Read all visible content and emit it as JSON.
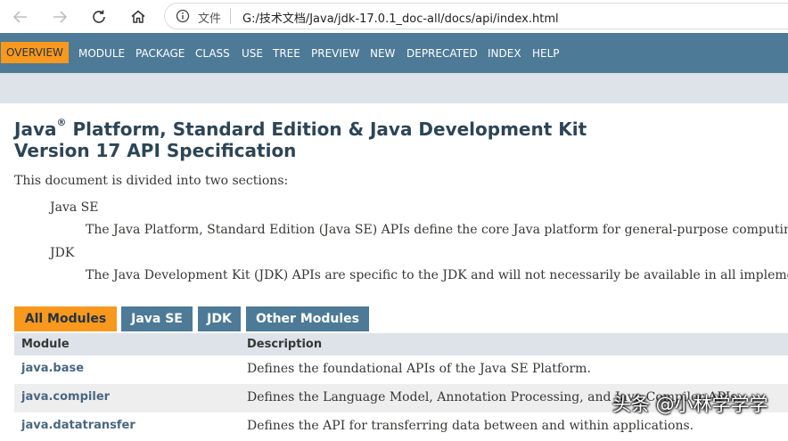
{
  "browser": {
    "file_label": "文件",
    "url": "G:/技术文档/Java/jdk-17.0.1_doc-all/docs/api/index.html",
    "icons": [
      "back-arrow-icon",
      "forward-arrow-icon",
      "reload-icon",
      "home-icon",
      "info-icon"
    ]
  },
  "topnav": {
    "items": [
      "OVERVIEW",
      "MODULE",
      "PACKAGE",
      "CLASS",
      "USE",
      "TREE",
      "PREVIEW",
      "NEW",
      "DEPRECATED",
      "INDEX",
      "HELP"
    ],
    "active_color": "#f8981d",
    "bar_color": "#4d7a97"
  },
  "header": {
    "title_java": "Java",
    "title_reg": "®",
    "title_rest": " Platform, Standard Edition & Java Development Kit",
    "title_line2": "Version 17 API Specification"
  },
  "intro": {
    "lead": "This document is divided into two sections:",
    "sections": [
      {
        "term": "Java SE",
        "desc": "The Java Platform, Standard Edition (Java SE) APIs define the core Java platform for general-purpose computin"
      },
      {
        "term": "JDK",
        "desc": "The Java Development Kit (JDK) APIs are specific to the JDK and will not necessarily be available in all impleme"
      }
    ]
  },
  "tabs": [
    "All Modules",
    "Java SE",
    "JDK",
    "Other Modules"
  ],
  "table": {
    "headers": [
      "Module",
      "Description"
    ],
    "rows": [
      {
        "module": "java.base",
        "description": "Defines the foundational APIs of the Java SE Platform."
      },
      {
        "module": "java.compiler",
        "description": "Defines the Language Model, Annotation Processing, and Java Compiler APIs."
      },
      {
        "module": "java.datatransfer",
        "description": "Defines the API for transferring data between and within applications."
      }
    ]
  },
  "watermark": "头条 @小林学学学"
}
